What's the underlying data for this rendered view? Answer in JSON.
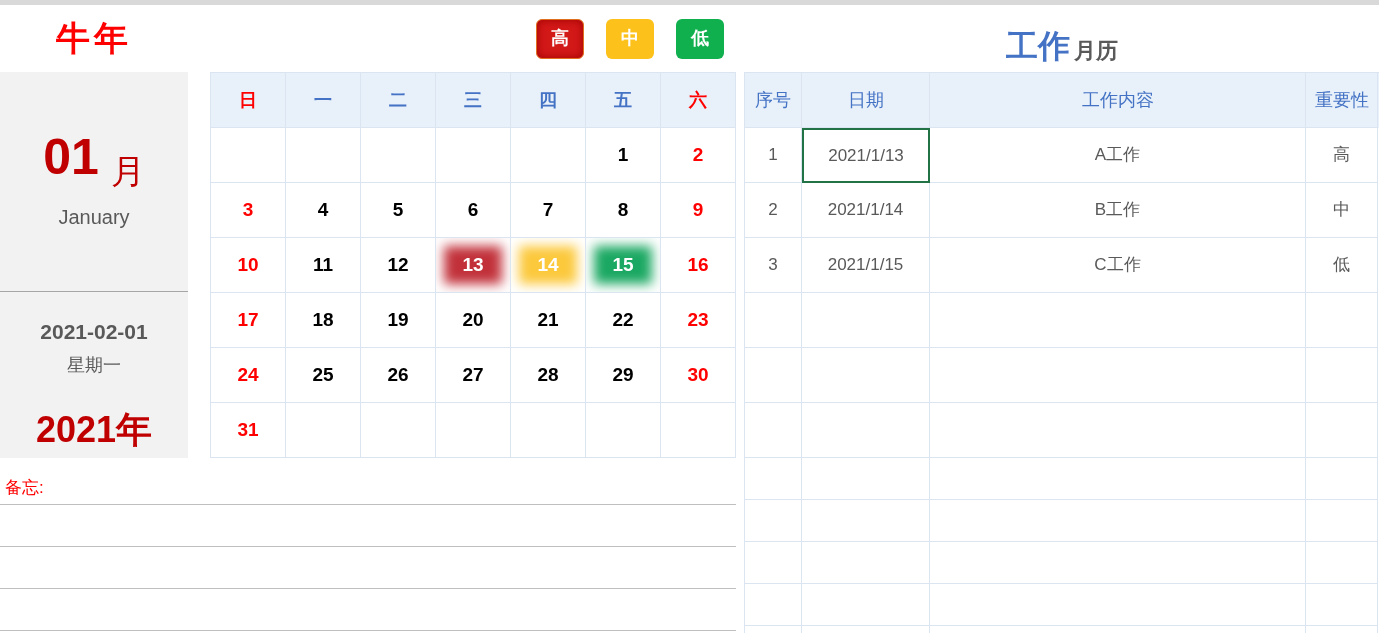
{
  "title": "牛年",
  "legend": [
    {
      "label": "高",
      "kind": "high"
    },
    {
      "label": "中",
      "kind": "medium"
    },
    {
      "label": "低",
      "kind": "low"
    }
  ],
  "month_panel": {
    "month_number": "01",
    "month_suffix": "月",
    "month_name": "January",
    "date": "2021-02-01",
    "weekday": "星期一",
    "year": "2021年"
  },
  "calendar": {
    "weekdays": [
      {
        "label": "日",
        "weekend": true
      },
      {
        "label": "一",
        "weekend": false
      },
      {
        "label": "二",
        "weekend": false
      },
      {
        "label": "三",
        "weekend": false
      },
      {
        "label": "四",
        "weekend": false
      },
      {
        "label": "五",
        "weekend": false
      },
      {
        "label": "六",
        "weekend": true
      }
    ],
    "weeks": [
      {
        "kind": "end",
        "days": [
          {
            "day": "1",
            "weekend": false
          },
          {
            "day": "2",
            "weekend": true
          }
        ]
      },
      {
        "kind": "full",
        "days": [
          {
            "day": "3",
            "weekend": true
          },
          {
            "day": "4",
            "weekend": false
          },
          {
            "day": "5",
            "weekend": false
          },
          {
            "day": "6",
            "weekend": false
          },
          {
            "day": "7",
            "weekend": false
          },
          {
            "day": "8",
            "weekend": false
          },
          {
            "day": "9",
            "weekend": true
          }
        ]
      },
      {
        "kind": "full",
        "days": [
          {
            "day": "10",
            "weekend": true
          },
          {
            "day": "11",
            "weekend": false
          },
          {
            "day": "12",
            "weekend": false
          },
          {
            "day": "13",
            "weekend": false,
            "color": "#c2313a"
          },
          {
            "day": "14",
            "weekend": false,
            "color": "#fcc93c"
          },
          {
            "day": "15",
            "weekend": false,
            "color": "#1aa862"
          },
          {
            "day": "16",
            "weekend": true
          }
        ]
      },
      {
        "kind": "full",
        "days": [
          {
            "day": "17",
            "weekend": true
          },
          {
            "day": "18",
            "weekend": false
          },
          {
            "day": "19",
            "weekend": false
          },
          {
            "day": "20",
            "weekend": false
          },
          {
            "day": "21",
            "weekend": false
          },
          {
            "day": "22",
            "weekend": false
          },
          {
            "day": "23",
            "weekend": true
          }
        ]
      },
      {
        "kind": "full",
        "days": [
          {
            "day": "24",
            "weekend": true
          },
          {
            "day": "25",
            "weekend": false
          },
          {
            "day": "26",
            "weekend": false
          },
          {
            "day": "27",
            "weekend": false
          },
          {
            "day": "28",
            "weekend": false
          },
          {
            "day": "29",
            "weekend": false
          },
          {
            "day": "30",
            "weekend": true
          }
        ]
      },
      {
        "kind": "start",
        "days": [
          {
            "day": "31",
            "weekend": true
          }
        ]
      }
    ]
  },
  "memo": {
    "label": "备忘:"
  },
  "work_title": {
    "main": "工作",
    "suffix": "月历"
  },
  "table": {
    "columns": [
      "序号",
      "日期",
      "工作内容",
      "重要性"
    ],
    "rows": [
      {
        "cells": [
          "1",
          "2021/1/13",
          "A工作",
          "高"
        ],
        "selected": true
      },
      {
        "cells": [
          "2",
          "2021/1/14",
          "B工作",
          "中"
        ],
        "selected": false
      },
      {
        "cells": [
          "3",
          "2021/1/15",
          "C工作",
          "低"
        ],
        "selected": false
      }
    ]
  }
}
